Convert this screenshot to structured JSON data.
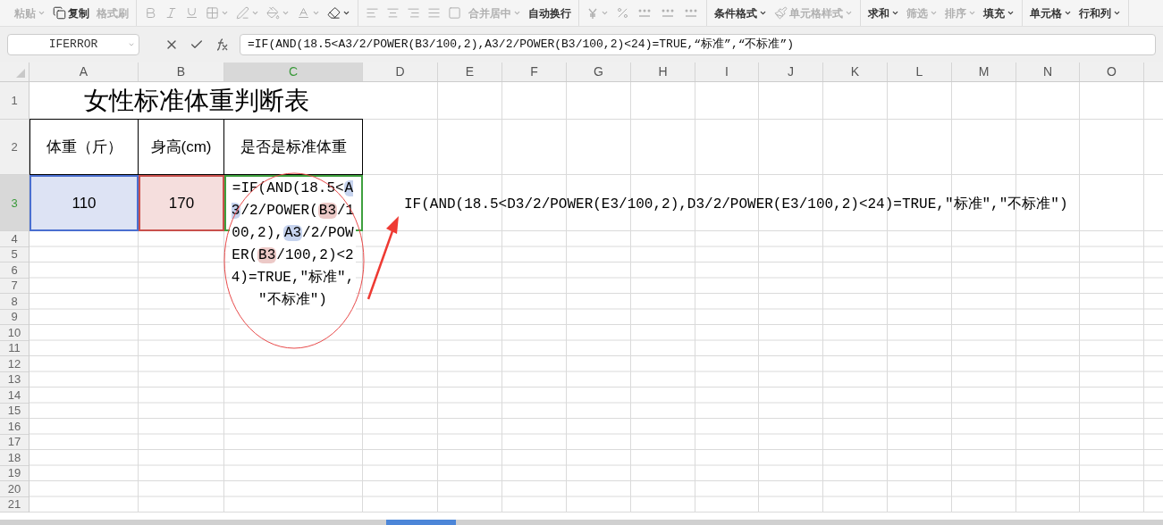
{
  "toolbar": {
    "groups": [
      [
        {
          "label": "粘贴",
          "kind": "text",
          "dropdown": true,
          "disabled": true
        },
        {
          "label": "复制",
          "kind": "copy",
          "dropdown": false,
          "disabled": false
        },
        {
          "label": "格式刷",
          "kind": "text",
          "dropdown": false,
          "disabled": true
        }
      ],
      [
        {
          "kind": "bold",
          "dropdown": false,
          "disabled": true
        },
        {
          "kind": "italic",
          "dropdown": false,
          "disabled": true
        },
        {
          "kind": "underline",
          "dropdown": false,
          "disabled": true
        },
        {
          "kind": "border",
          "dropdown": true,
          "disabled": true
        },
        {
          "kind": "pen",
          "dropdown": true,
          "disabled": true
        },
        {
          "kind": "fill",
          "dropdown": true,
          "disabled": true
        },
        {
          "kind": "fontcolor",
          "dropdown": true,
          "disabled": true
        },
        {
          "kind": "eraser",
          "dropdown": true,
          "disabled": false
        }
      ],
      [
        {
          "kind": "align-left",
          "dropdown": false,
          "disabled": true
        },
        {
          "kind": "align-center",
          "dropdown": false,
          "disabled": true
        },
        {
          "kind": "align-right",
          "dropdown": false,
          "disabled": true
        },
        {
          "kind": "justify",
          "dropdown": false,
          "disabled": true
        },
        {
          "kind": "box",
          "dropdown": false,
          "disabled": true
        },
        {
          "label": "合并居中",
          "kind": "text",
          "dropdown": true,
          "disabled": true
        },
        {
          "label": "自动换行",
          "kind": "text",
          "dropdown": false,
          "disabled": false
        }
      ],
      [
        {
          "kind": "currency",
          "dropdown": true,
          "disabled": true
        },
        {
          "kind": "percent",
          "dropdown": false,
          "disabled": true
        },
        {
          "kind": "thousands",
          "dropdown": false,
          "disabled": true
        },
        {
          "kind": "dec-inc",
          "dropdown": false,
          "disabled": true
        },
        {
          "kind": "dec-dec",
          "dropdown": false,
          "disabled": true
        }
      ],
      [
        {
          "label": "条件格式",
          "kind": "text",
          "dropdown": true,
          "disabled": false
        },
        {
          "label": "单元格样式",
          "kind": "style",
          "dropdown": true,
          "disabled": true
        }
      ],
      [
        {
          "label": "求和",
          "kind": "text",
          "dropdown": true,
          "disabled": false
        },
        {
          "label": "筛选",
          "kind": "text",
          "dropdown": true,
          "disabled": true
        },
        {
          "label": "排序",
          "kind": "text",
          "dropdown": true,
          "disabled": true
        },
        {
          "label": "填充",
          "kind": "text",
          "dropdown": true,
          "disabled": false
        }
      ],
      [
        {
          "label": "单元格",
          "kind": "text",
          "dropdown": true,
          "disabled": false
        },
        {
          "label": "行和列",
          "kind": "text",
          "dropdown": true,
          "disabled": false
        }
      ]
    ]
  },
  "name_box": {
    "value": "IFERROR"
  },
  "formula_bar": {
    "value": "=IF(AND(18.5<A3/2/POWER(B3/100,2),A3/2/POWER(B3/100,2)<24)=TRUE,“标准”,“不标准”)"
  },
  "columns": [
    {
      "label": "A",
      "selected": false
    },
    {
      "label": "B",
      "selected": false
    },
    {
      "label": "C",
      "selected": true
    },
    {
      "label": "D",
      "selected": false
    },
    {
      "label": "E",
      "selected": false
    },
    {
      "label": "F",
      "selected": false
    },
    {
      "label": "G",
      "selected": false
    },
    {
      "label": "H",
      "selected": false
    },
    {
      "label": "I",
      "selected": false
    },
    {
      "label": "J",
      "selected": false
    },
    {
      "label": "K",
      "selected": false
    },
    {
      "label": "L",
      "selected": false
    },
    {
      "label": "M",
      "selected": false
    },
    {
      "label": "N",
      "selected": false
    },
    {
      "label": "O",
      "selected": false
    }
  ],
  "rows": [
    {
      "label": "1",
      "selected": false
    },
    {
      "label": "2",
      "selected": false
    },
    {
      "label": "3",
      "selected": true
    },
    {
      "label": "4",
      "selected": false
    },
    {
      "label": "5",
      "selected": false
    },
    {
      "label": "6",
      "selected": false
    },
    {
      "label": "7",
      "selected": false
    },
    {
      "label": "8",
      "selected": false
    },
    {
      "label": "9",
      "selected": false
    },
    {
      "label": "10",
      "selected": false
    },
    {
      "label": "11",
      "selected": false
    },
    {
      "label": "12",
      "selected": false
    },
    {
      "label": "13",
      "selected": false
    },
    {
      "label": "14",
      "selected": false
    },
    {
      "label": "15",
      "selected": false
    },
    {
      "label": "16",
      "selected": false
    },
    {
      "label": "17",
      "selected": false
    },
    {
      "label": "18",
      "selected": false
    },
    {
      "label": "19",
      "selected": false
    },
    {
      "label": "20",
      "selected": false
    },
    {
      "label": "21",
      "selected": false
    }
  ],
  "sheet": {
    "title": "女性标准体重判断表",
    "headers": [
      "体重（斤）",
      "身高(cm)",
      "是否是标准体重"
    ],
    "values": [
      {
        "text": "110",
        "color": "#dde3f4"
      },
      {
        "text": "170",
        "color": "#f5dedd"
      }
    ],
    "formula_cell": [
      {
        "text": "=IF(AND(18.5<"
      },
      {
        "text": "A3",
        "color": "#c6d3ee"
      },
      {
        "text": "/2/POWER("
      },
      {
        "text": "B3",
        "color": "#ecc9c7"
      },
      {
        "text": "/100,2),"
      },
      {
        "text": "A3",
        "color": "#c6d3ee"
      },
      {
        "text": "/2/POWER("
      },
      {
        "text": "B3",
        "color": "#ecc9c7"
      },
      {
        "text": "/100,2)<24)=TRUE,″标准″,″不标准″)"
      }
    ],
    "note": "IF(AND(18.5<D3/2/POWER(E3/100,2),D3/2/POWER(E3/100,2)<24)=TRUE,″标准″,″不标准″)"
  }
}
